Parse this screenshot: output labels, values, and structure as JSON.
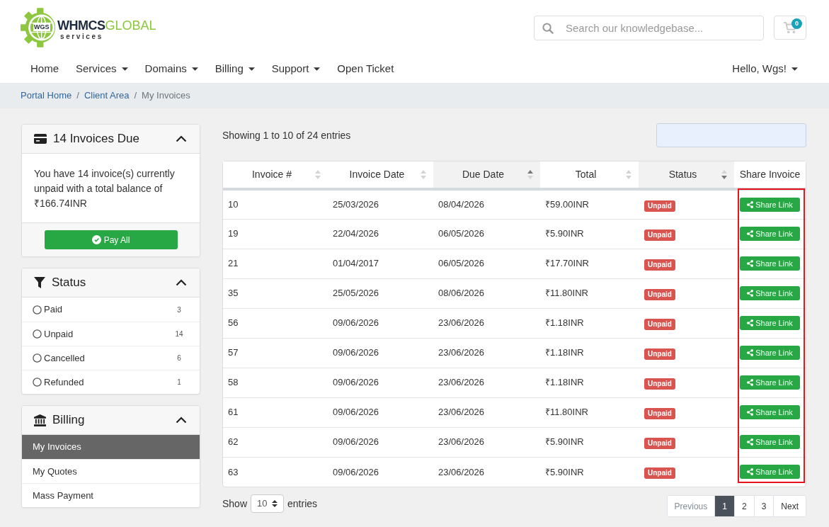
{
  "logo": {
    "badge": "WGS",
    "brand": "WHMCS",
    "brand_accent": "GLOBAL",
    "tagline": "services"
  },
  "search": {
    "placeholder": "Search our knowledgebase..."
  },
  "cart": {
    "count": "0"
  },
  "nav": {
    "items": [
      {
        "label": "Home",
        "kind": "link"
      },
      {
        "label": "Services",
        "kind": "dropdown"
      },
      {
        "label": "Domains",
        "kind": "dropdown"
      },
      {
        "label": "Billing",
        "kind": "dropdown"
      },
      {
        "label": "Support",
        "kind": "dropdown"
      },
      {
        "label": "Open Ticket",
        "kind": "link"
      }
    ],
    "user": {
      "label": "Hello, Wgs!",
      "kind": "dropdown"
    }
  },
  "breadcrumb": [
    {
      "label": "Portal Home",
      "current": false
    },
    {
      "separator": "/",
      "label": "Client Area",
      "current": false
    },
    {
      "separator": "/",
      "label": "My Invoices",
      "current": true
    }
  ],
  "sidebar": {
    "panels": [
      {
        "kind": "summary",
        "title": "14 Invoices Due",
        "expanded": true,
        "text": "You have 14 invoice(s) currently unpaid with a total balance of ₹166.74INR",
        "button": "Pay All"
      },
      {
        "kind": "filter",
        "title": "Status",
        "expanded": true,
        "items": [
          {
            "label": "Paid",
            "count": "3",
            "selected": false
          },
          {
            "label": "Unpaid",
            "count": "14",
            "selected": false
          },
          {
            "label": "Cancelled",
            "count": "6",
            "selected": false
          },
          {
            "label": "Refunded",
            "count": "1",
            "selected": false
          }
        ]
      },
      {
        "kind": "menu",
        "title": "Billing",
        "expanded": true,
        "items": [
          {
            "label": "My Invoices",
            "selected": true
          },
          {
            "label": "My Quotes",
            "selected": false
          },
          {
            "label": "Mass Payment",
            "selected": false
          }
        ]
      }
    ]
  },
  "table": {
    "info": "Showing 1 to 10 of 24 entries",
    "columns": [
      {
        "label": "Invoice #",
        "sorted": false,
        "highlighted": false
      },
      {
        "label": "Invoice Date",
        "sorted": false,
        "highlighted": false
      },
      {
        "label": "Due Date",
        "sorted": true,
        "descending": false,
        "highlighted": false
      },
      {
        "label": "Total",
        "sorted": false,
        "highlighted": false
      },
      {
        "label": "Status",
        "sorted": true,
        "descending": true,
        "highlighted": false
      },
      {
        "label": "Share Invoice",
        "highlighted": true
      }
    ],
    "rows": [
      {
        "invoice": "10",
        "invoice_date": "25/03/2026",
        "due_date": "08/04/2026",
        "total": "₹59.00INR",
        "status": "Unpaid",
        "share": "Share Link"
      },
      {
        "invoice": "19",
        "invoice_date": "22/04/2026",
        "due_date": "06/05/2026",
        "total": "₹5.90INR",
        "status": "Unpaid",
        "share": "Share Link"
      },
      {
        "invoice": "21",
        "invoice_date": "01/04/2017",
        "due_date": "06/05/2026",
        "total": "₹17.70INR",
        "status": "Unpaid",
        "share": "Share Link"
      },
      {
        "invoice": "35",
        "invoice_date": "25/05/2026",
        "due_date": "08/06/2026",
        "total": "₹11.80INR",
        "status": "Unpaid",
        "share": "Share Link"
      },
      {
        "invoice": "56",
        "invoice_date": "09/06/2026",
        "due_date": "23/06/2026",
        "total": "₹1.18INR",
        "status": "Unpaid",
        "share": "Share Link"
      },
      {
        "invoice": "57",
        "invoice_date": "09/06/2026",
        "due_date": "23/06/2026",
        "total": "₹1.18INR",
        "status": "Unpaid",
        "share": "Share Link"
      },
      {
        "invoice": "58",
        "invoice_date": "09/06/2026",
        "due_date": "23/06/2026",
        "total": "₹1.18INR",
        "status": "Unpaid",
        "share": "Share Link"
      },
      {
        "invoice": "61",
        "invoice_date": "09/06/2026",
        "due_date": "23/06/2026",
        "total": "₹11.80INR",
        "status": "Unpaid",
        "share": "Share Link"
      },
      {
        "invoice": "62",
        "invoice_date": "09/06/2026",
        "due_date": "23/06/2026",
        "total": "₹5.90INR",
        "status": "Unpaid",
        "share": "Share Link"
      },
      {
        "invoice": "63",
        "invoice_date": "09/06/2026",
        "due_date": "23/06/2026",
        "total": "₹5.90INR",
        "status": "Unpaid",
        "share": "Share Link"
      }
    ],
    "length": {
      "before": "Show",
      "value": "10",
      "after": "entries"
    },
    "pagination": [
      {
        "label": "Previous",
        "selected": false,
        "disabled": true
      },
      {
        "label": "1",
        "selected": true,
        "disabled": false
      },
      {
        "label": "2",
        "selected": false,
        "disabled": false
      },
      {
        "label": "3",
        "selected": false,
        "disabled": false
      },
      {
        "label": "Next",
        "selected": false,
        "disabled": false
      }
    ]
  }
}
